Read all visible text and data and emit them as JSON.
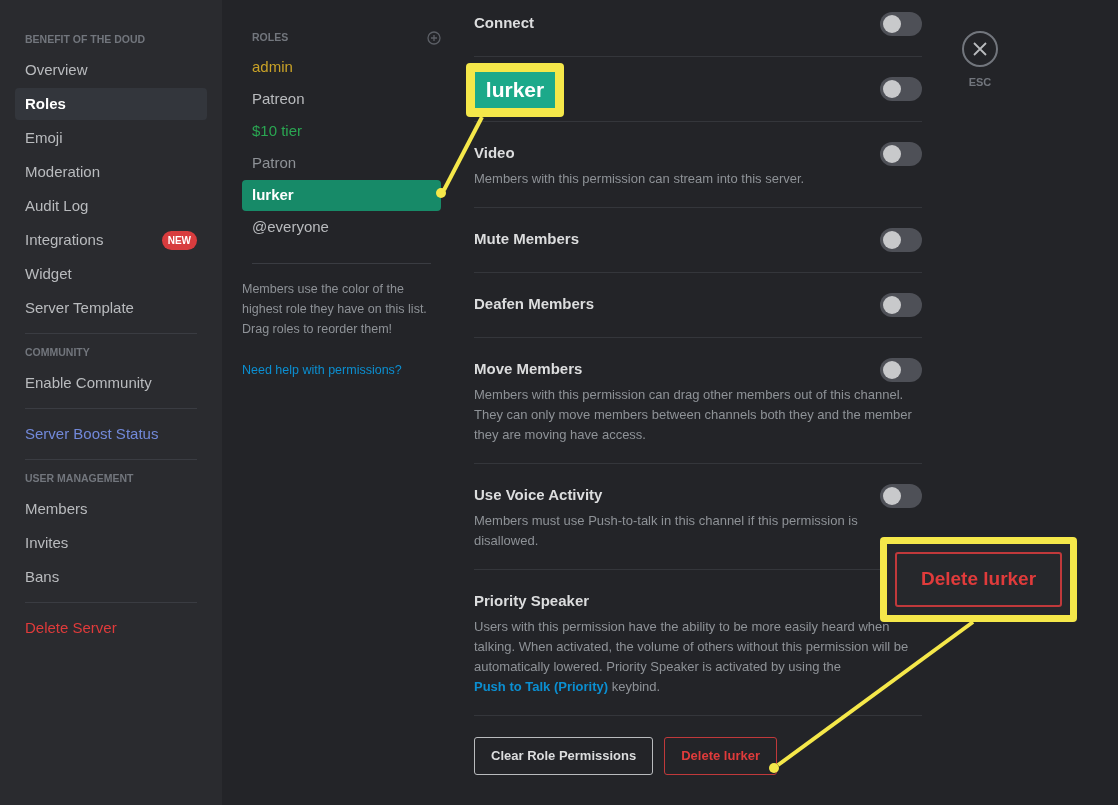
{
  "sidebar": {
    "sections": [
      {
        "header": "BENEFIT OF THE DOUD",
        "items": [
          {
            "label": "Overview",
            "kind": "normal",
            "selected": false
          },
          {
            "label": "Roles",
            "kind": "normal",
            "selected": true
          },
          {
            "label": "Emoji",
            "kind": "normal",
            "selected": false
          },
          {
            "label": "Moderation",
            "kind": "normal",
            "selected": false
          },
          {
            "label": "Audit Log",
            "kind": "normal",
            "selected": false
          },
          {
            "label": "Integrations",
            "kind": "normal",
            "selected": false,
            "badge": "NEW"
          },
          {
            "label": "Widget",
            "kind": "normal",
            "selected": false
          },
          {
            "label": "Server Template",
            "kind": "normal",
            "selected": false
          }
        ]
      },
      {
        "header": "COMMUNITY",
        "items": [
          {
            "label": "Enable Community",
            "kind": "normal",
            "selected": false
          }
        ]
      },
      {
        "items": [
          {
            "label": "Server Boost Status",
            "kind": "boost",
            "selected": false
          }
        ]
      },
      {
        "header": "USER MANAGEMENT",
        "items": [
          {
            "label": "Members",
            "kind": "normal",
            "selected": false
          },
          {
            "label": "Invites",
            "kind": "normal",
            "selected": false
          },
          {
            "label": "Bans",
            "kind": "normal",
            "selected": false
          }
        ]
      },
      {
        "items": [
          {
            "label": "Delete Server",
            "kind": "danger",
            "selected": false
          }
        ]
      }
    ]
  },
  "roles": {
    "header": "ROLES",
    "items": [
      {
        "name": "admin",
        "color": "#c9a227",
        "selected": false
      },
      {
        "name": "Patreon",
        "color": "#b9bbbe",
        "selected": false
      },
      {
        "name": "$10 tier",
        "color": "#2aa652",
        "selected": false
      },
      {
        "name": "Patron",
        "color": "#8e9297",
        "selected": false
      },
      {
        "name": "lurker",
        "color": "#178a68",
        "selected": true
      },
      {
        "name": "@everyone",
        "color": "#b9bbbe",
        "selected": false
      }
    ],
    "hint": "Members use the color of the highest role they have on this list. Drag roles to reorder them!",
    "help_link": "Need help with permissions?"
  },
  "permissions": [
    {
      "title": "Connect",
      "on": false
    },
    {
      "on": false
    },
    {
      "title": "Video",
      "on": false,
      "description": [
        {
          "kind": "text",
          "text": "Members with this permission can stream into this server."
        }
      ]
    },
    {
      "title": "Mute Members",
      "on": false
    },
    {
      "title": "Deafen Members",
      "on": false
    },
    {
      "title": "Move Members",
      "on": false,
      "description": [
        {
          "kind": "text",
          "text": "Members with this permission can drag other members out of this channel. They can only move members between channels both they and the member they are moving have access."
        }
      ]
    },
    {
      "title": "Use Voice Activity",
      "on": false,
      "description": [
        {
          "kind": "text",
          "text": "Members must use Push-to-talk in this channel if this permission is disallowed."
        }
      ]
    },
    {
      "title": "Priority Speaker",
      "description": [
        {
          "kind": "text",
          "text": "Users with this permission have the ability to be more easily heard when talking. When activated, the volume of others without this permission will be automatically lowered. Priority Speaker is activated by using the "
        },
        {
          "kind": "link",
          "text": "Push to Talk (Priority)"
        },
        {
          "kind": "text",
          "text": " keybind."
        }
      ]
    }
  ],
  "buttons": [
    {
      "label": "Clear Role Permissions",
      "kind": "outline"
    },
    {
      "label": "Delete lurker",
      "kind": "danger"
    }
  ],
  "close": {
    "label": "ESC"
  },
  "callouts": [
    {
      "kind": "role-label",
      "text": "lurker"
    },
    {
      "kind": "danger-button",
      "text": "Delete lurker"
    }
  ]
}
